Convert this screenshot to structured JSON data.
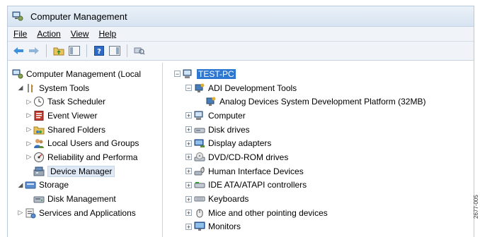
{
  "window": {
    "title": "Computer Management"
  },
  "menu": [
    "File",
    "Action",
    "View",
    "Help"
  ],
  "left_tree": {
    "root": "Computer Management (Local",
    "system_tools": "System Tools",
    "task_scheduler": "Task Scheduler",
    "event_viewer": "Event Viewer",
    "shared_folders": "Shared Folders",
    "local_users": "Local Users and Groups",
    "reliability": "Reliability and Performa",
    "device_manager": "Device Manager",
    "storage": "Storage",
    "disk_management": "Disk Management",
    "services": "Services and Applications"
  },
  "right_tree": {
    "pc": "TEST-PC",
    "adi_tools": "ADI Development Tools",
    "adi_platform": "Analog Devices System Development Platform (32MB)",
    "items": [
      "Computer",
      "Disk drives",
      "Display adapters",
      "DVD/CD-ROM drives",
      "Human Interface Devices",
      "IDE ATA/ATAPI controllers",
      "Keyboards",
      "Mice and other pointing devices",
      "Monitors"
    ]
  },
  "figure_code": "2677-005"
}
